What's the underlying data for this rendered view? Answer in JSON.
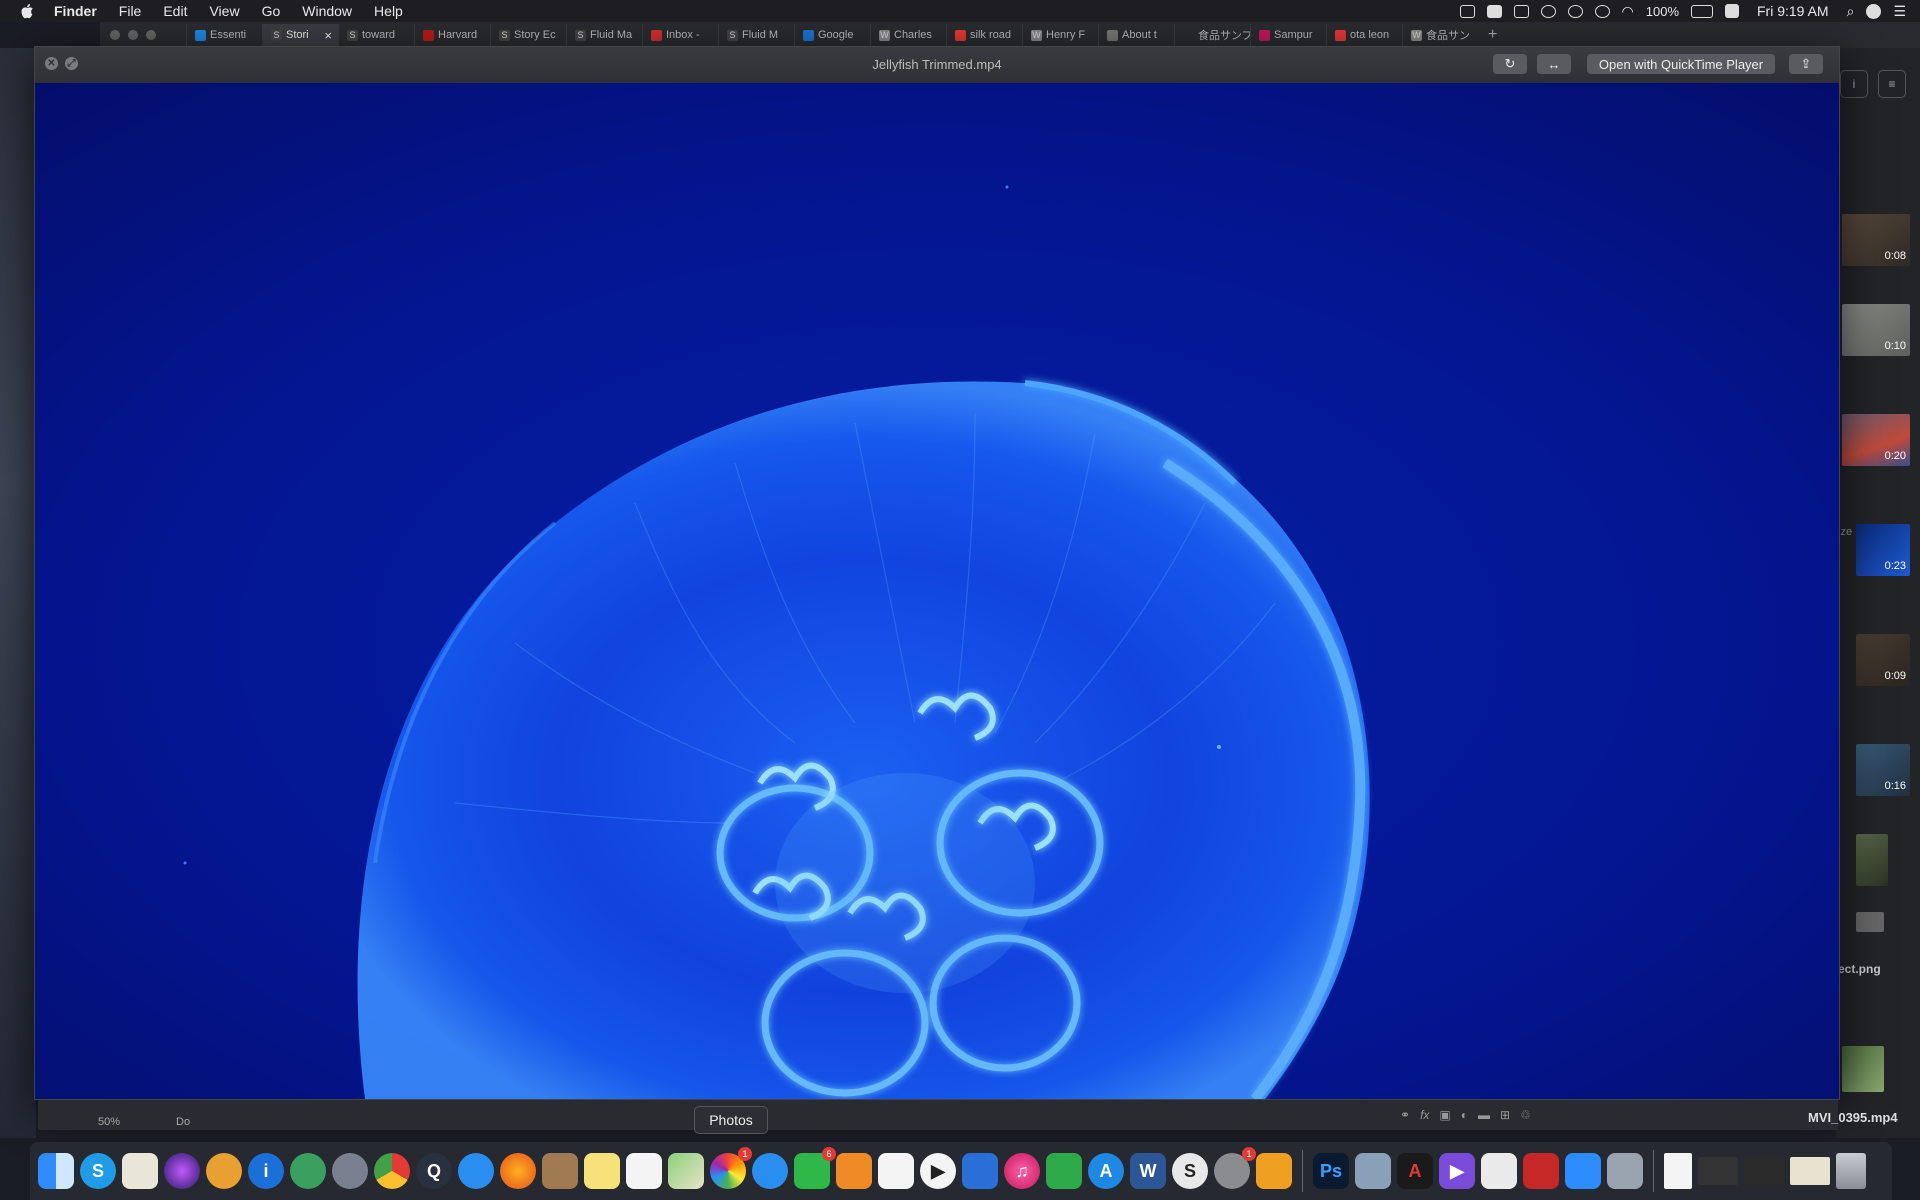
{
  "menubar": {
    "app_name": "Finder",
    "menus": [
      "File",
      "Edit",
      "View",
      "Go",
      "Window",
      "Help"
    ],
    "battery": "100%",
    "clock": "Fri 9:19 AM"
  },
  "browser_tabs": [
    {
      "label": "Essenti",
      "color": "#1e88e5"
    },
    {
      "label": "Stori",
      "color": "#444",
      "glyph": "S",
      "active": true
    },
    {
      "label": "toward",
      "color": "#444",
      "glyph": "S"
    },
    {
      "label": "Harvard",
      "color": "#b71c1c"
    },
    {
      "label": "Story Ec",
      "color": "#444",
      "glyph": "S"
    },
    {
      "label": "Fluid Ma",
      "color": "#444",
      "glyph": "S"
    },
    {
      "label": "Inbox -",
      "color": "#d32f2f"
    },
    {
      "label": "Fluid M",
      "color": "#444",
      "glyph": "S"
    },
    {
      "label": "Google",
      "color": "#1976d2"
    },
    {
      "label": "Charles",
      "color": "#888",
      "glyph": "W"
    },
    {
      "label": "silk road",
      "color": "#e53935"
    },
    {
      "label": "Henry F",
      "color": "#888",
      "glyph": "W"
    },
    {
      "label": "About t",
      "color": "#777"
    },
    {
      "label": "食品サンプル",
      "color": "#2a2b30"
    },
    {
      "label": "Sampur",
      "color": "#c2185b"
    },
    {
      "label": "ota leon",
      "color": "#e53935"
    },
    {
      "label": "食品サン",
      "color": "#888",
      "glyph": "W"
    }
  ],
  "quicklook": {
    "title": "Jellyfish Trimmed.mp4",
    "open_with_label": "Open with QuickTime Player"
  },
  "photos_sidebar": {
    "durations": [
      "0:08",
      "0:10",
      "0:20",
      "0:23",
      "0:09",
      "0:16"
    ],
    "file_label_1": "ect.png",
    "file_label_2": "MVI_0395.mp4",
    "partial_label": "ize"
  },
  "under_strip": {
    "zoom": "50%",
    "doc": "Do"
  },
  "dock": {
    "tooltip": "Photos",
    "photos_badge": "1",
    "facetime_badge": "6",
    "prefs_badge": "1"
  }
}
